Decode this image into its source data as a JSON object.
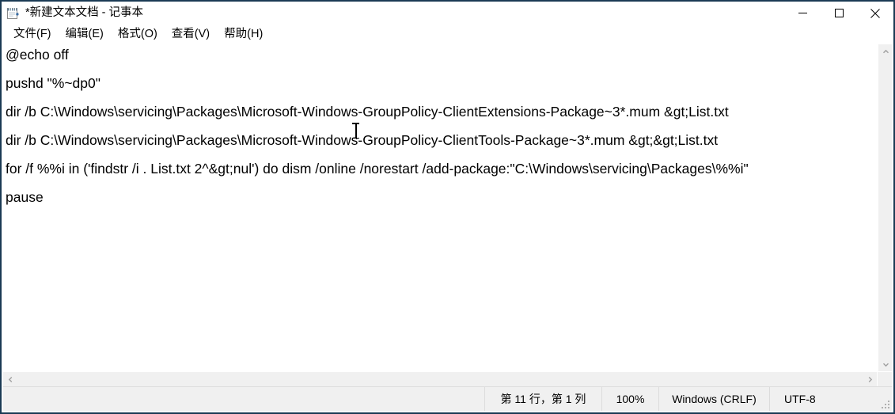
{
  "window": {
    "title": "*新建文本文档 - 记事本",
    "icon": "notepad-icon",
    "border_color": "#1b3a54",
    "controls": {
      "minimize": "minimize-icon",
      "maximize": "maximize-icon",
      "close": "close-icon"
    }
  },
  "menubar": {
    "items": [
      {
        "label": "文件(F)"
      },
      {
        "label": "编辑(E)"
      },
      {
        "label": "格式(O)"
      },
      {
        "label": "查看(V)"
      },
      {
        "label": "帮助(H)"
      }
    ]
  },
  "editor": {
    "lines": [
      "@echo off",
      "",
      "pushd \"%~dp0\"",
      "",
      "dir /b C:\\Windows\\servicing\\Packages\\Microsoft-Windows-GroupPolicy-ClientExtensions-Package~3*.mum &gt;List.txt",
      "",
      "dir /b C:\\Windows\\servicing\\Packages\\Microsoft-Windows-GroupPolicy-ClientTools-Package~3*.mum &gt;&gt;List.txt",
      "",
      "for /f %%i in ('findstr /i . List.txt 2^&gt;nul') do dism /online /norestart /add-package:\"C:\\Windows\\servicing\\Packages\\%%i\"",
      "",
      "pause"
    ]
  },
  "scrollbars": {
    "vertical": {
      "up_arrow": "chevron-up-icon",
      "down_arrow": "chevron-down-icon"
    },
    "horizontal": {
      "left_arrow": "chevron-left-icon",
      "right_arrow": "chevron-right-icon"
    }
  },
  "statusbar": {
    "position": "第 11 行，第 1 列",
    "zoom": "100%",
    "line_ending": "Windows (CRLF)",
    "encoding": "UTF-8",
    "grip": "resize-grip-icon"
  }
}
